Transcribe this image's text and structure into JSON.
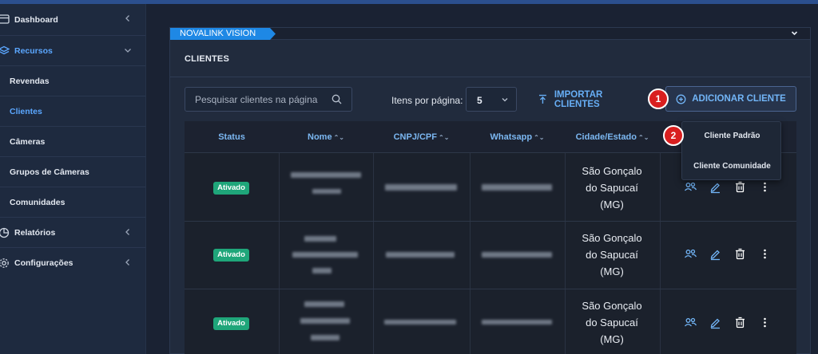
{
  "sidebar": {
    "items": [
      {
        "label": "Dashboard",
        "icon": "dashboard-icon",
        "chevron": "chevron-left-icon"
      },
      {
        "label": "Recursos",
        "icon": "layers-icon",
        "chevron": "chevron-down-icon"
      },
      {
        "label": "Revendas"
      },
      {
        "label": "Clientes"
      },
      {
        "label": "Câmeras"
      },
      {
        "label": "Grupos de Câmeras"
      },
      {
        "label": "Comunidades"
      },
      {
        "label": "Relatórios",
        "icon": "pie-chart-icon",
        "chevron": "chevron-left-icon"
      },
      {
        "label": "Configurações",
        "icon": "gear-icon",
        "chevron": "chevron-left-icon"
      }
    ]
  },
  "panel": {
    "vision_label": "NOVALINK VISION",
    "title": "CLIENTES"
  },
  "toolbar": {
    "search_placeholder": "Pesquisar clientes na página",
    "items_per_page_label": "Itens por página:",
    "items_per_page_value": "5",
    "import_label": "IMPORTAR CLIENTES",
    "add_label": "ADICIONAR CLIENTE"
  },
  "markers": [
    "1",
    "2"
  ],
  "dropdown": {
    "items": [
      "Cliente Padrão",
      "Cliente Comunidade"
    ]
  },
  "table": {
    "headers": [
      "Status",
      "Nome",
      "CNPJ/CPF",
      "Whatsapp",
      "Cidade/Estado"
    ],
    "sort_icon": "⌃⌄",
    "rows": [
      {
        "status": "Ativado",
        "city": [
          "São Gonçalo",
          "do Sapucaí",
          "(MG)"
        ]
      },
      {
        "status": "Ativado",
        "city": [
          "São Gonçalo",
          "do Sapucaí",
          "(MG)"
        ]
      },
      {
        "status": "Ativado",
        "city": [
          "São Gonçalo",
          "do Sapucaí",
          "(MG)"
        ]
      }
    ]
  },
  "colors": {
    "accent": "#1e88e5",
    "link": "#67aef5",
    "status_active": "#1fa67a",
    "marker": "#d91f1f"
  }
}
